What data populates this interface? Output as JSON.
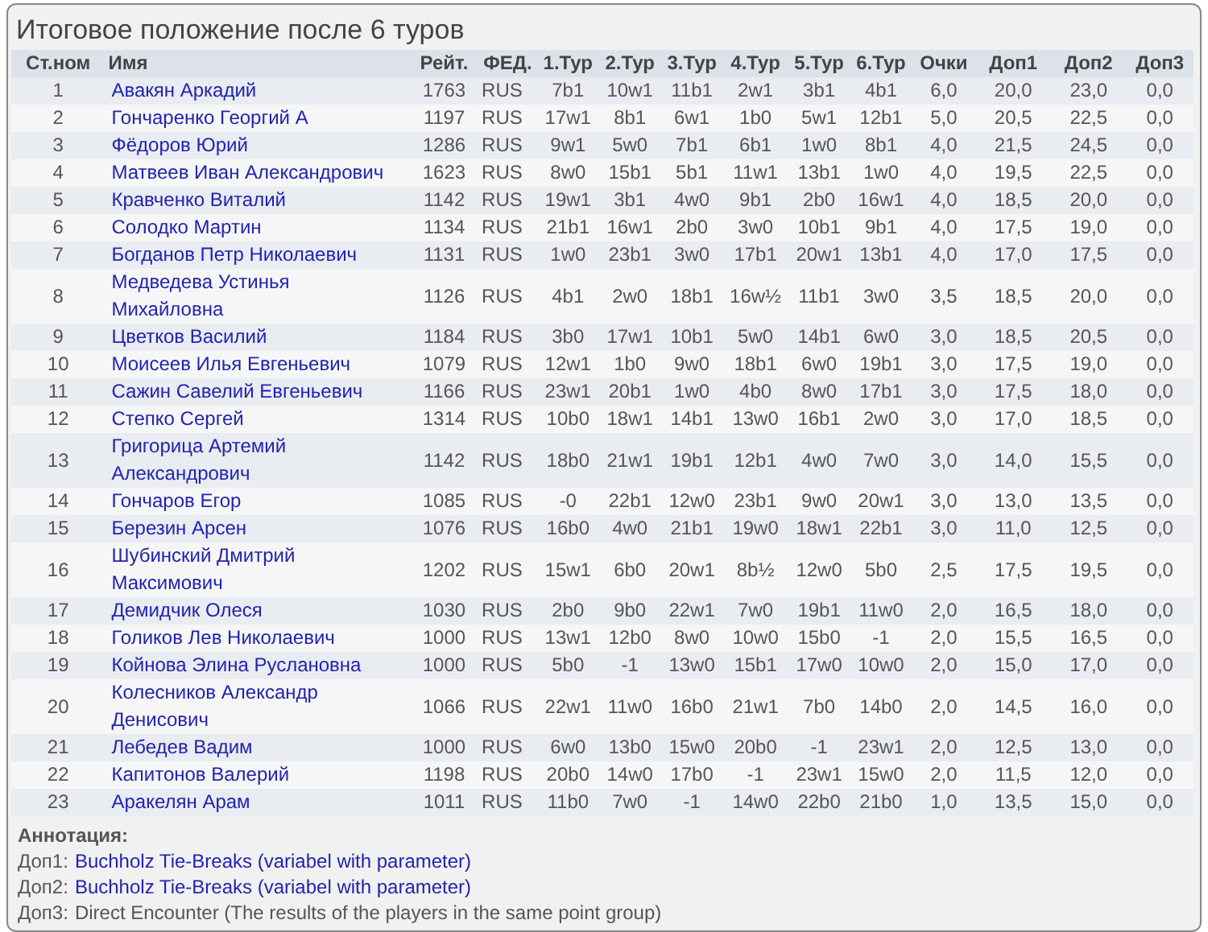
{
  "title": "Итоговое положение после 6 туров",
  "table": {
    "columns": [
      "Ст.ном",
      "Имя",
      "Рейт.",
      "ФЕД.",
      "1.Тур",
      "2.Тур",
      "3.Тур",
      "4.Тур",
      "5.Тур",
      "6.Тур",
      "Очки",
      "Доп1",
      "Доп2",
      "Доп3"
    ],
    "rows": [
      {
        "rank": "1",
        "name": "Авакян Аркадий",
        "rating": "1763",
        "fed": "RUS",
        "rounds": [
          "7b1",
          "10w1",
          "11b1",
          "2w1",
          "3b1",
          "4b1"
        ],
        "points": "6,0",
        "tb1": "20,0",
        "tb2": "23,0",
        "tb3": "0,0"
      },
      {
        "rank": "2",
        "name": "Гончаренко Георгий А",
        "rating": "1197",
        "fed": "RUS",
        "rounds": [
          "17w1",
          "8b1",
          "6w1",
          "1b0",
          "5w1",
          "12b1"
        ],
        "points": "5,0",
        "tb1": "20,5",
        "tb2": "22,5",
        "tb3": "0,0"
      },
      {
        "rank": "3",
        "name": "Фёдоров Юрий",
        "rating": "1286",
        "fed": "RUS",
        "rounds": [
          "9w1",
          "5w0",
          "7b1",
          "6b1",
          "1w0",
          "8b1"
        ],
        "points": "4,0",
        "tb1": "21,5",
        "tb2": "24,5",
        "tb3": "0,0"
      },
      {
        "rank": "4",
        "name": "Матвеев Иван Александрович",
        "rating": "1623",
        "fed": "RUS",
        "rounds": [
          "8w0",
          "15b1",
          "5b1",
          "11w1",
          "13b1",
          "1w0"
        ],
        "points": "4,0",
        "tb1": "19,5",
        "tb2": "22,5",
        "tb3": "0,0"
      },
      {
        "rank": "5",
        "name": "Кравченко Виталий",
        "rating": "1142",
        "fed": "RUS",
        "rounds": [
          "19w1",
          "3b1",
          "4w0",
          "9b1",
          "2b0",
          "16w1"
        ],
        "points": "4,0",
        "tb1": "18,5",
        "tb2": "20,0",
        "tb3": "0,0"
      },
      {
        "rank": "6",
        "name": "Солодко Мартин",
        "rating": "1134",
        "fed": "RUS",
        "rounds": [
          "21b1",
          "16w1",
          "2b0",
          "3w0",
          "10b1",
          "9b1"
        ],
        "points": "4,0",
        "tb1": "17,5",
        "tb2": "19,0",
        "tb3": "0,0"
      },
      {
        "rank": "7",
        "name": "Богданов Петр Николаевич",
        "rating": "1131",
        "fed": "RUS",
        "rounds": [
          "1w0",
          "23b1",
          "3w0",
          "17b1",
          "20w1",
          "13b1"
        ],
        "points": "4,0",
        "tb1": "17,0",
        "tb2": "17,5",
        "tb3": "0,0"
      },
      {
        "rank": "8",
        "name": "Медведева Устинья Михайловна",
        "rating": "1126",
        "fed": "RUS",
        "rounds": [
          "4b1",
          "2w0",
          "18b1",
          "16w½",
          "11b1",
          "3w0"
        ],
        "points": "3,5",
        "tb1": "18,5",
        "tb2": "20,0",
        "tb3": "0,0"
      },
      {
        "rank": "9",
        "name": "Цветков Василий",
        "rating": "1184",
        "fed": "RUS",
        "rounds": [
          "3b0",
          "17w1",
          "10b1",
          "5w0",
          "14b1",
          "6w0"
        ],
        "points": "3,0",
        "tb1": "18,5",
        "tb2": "20,5",
        "tb3": "0,0"
      },
      {
        "rank": "10",
        "name": "Моисеев Илья Евгеньевич",
        "rating": "1079",
        "fed": "RUS",
        "rounds": [
          "12w1",
          "1b0",
          "9w0",
          "18b1",
          "6w0",
          "19b1"
        ],
        "points": "3,0",
        "tb1": "17,5",
        "tb2": "19,0",
        "tb3": "0,0"
      },
      {
        "rank": "11",
        "name": "Сажин Савелий Евгеньевич",
        "rating": "1166",
        "fed": "RUS",
        "rounds": [
          "23w1",
          "20b1",
          "1w0",
          "4b0",
          "8w0",
          "17b1"
        ],
        "points": "3,0",
        "tb1": "17,5",
        "tb2": "18,0",
        "tb3": "0,0"
      },
      {
        "rank": "12",
        "name": "Степко Сергей",
        "rating": "1314",
        "fed": "RUS",
        "rounds": [
          "10b0",
          "18w1",
          "14b1",
          "13w0",
          "16b1",
          "2w0"
        ],
        "points": "3,0",
        "tb1": "17,0",
        "tb2": "18,5",
        "tb3": "0,0"
      },
      {
        "rank": "13",
        "name": "Григорица Артемий Александрович",
        "rating": "1142",
        "fed": "RUS",
        "rounds": [
          "18b0",
          "21w1",
          "19b1",
          "12b1",
          "4w0",
          "7w0"
        ],
        "points": "3,0",
        "tb1": "14,0",
        "tb2": "15,5",
        "tb3": "0,0"
      },
      {
        "rank": "14",
        "name": "Гончаров Егор",
        "rating": "1085",
        "fed": "RUS",
        "rounds": [
          "-0",
          "22b1",
          "12w0",
          "23b1",
          "9w0",
          "20w1"
        ],
        "points": "3,0",
        "tb1": "13,0",
        "tb2": "13,5",
        "tb3": "0,0"
      },
      {
        "rank": "15",
        "name": "Березин Арсен",
        "rating": "1076",
        "fed": "RUS",
        "rounds": [
          "16b0",
          "4w0",
          "21b1",
          "19w0",
          "18w1",
          "22b1"
        ],
        "points": "3,0",
        "tb1": "11,0",
        "tb2": "12,5",
        "tb3": "0,0"
      },
      {
        "rank": "16",
        "name": "Шубинский Дмитрий Максимович",
        "rating": "1202",
        "fed": "RUS",
        "rounds": [
          "15w1",
          "6b0",
          "20w1",
          "8b½",
          "12w0",
          "5b0"
        ],
        "points": "2,5",
        "tb1": "17,5",
        "tb2": "19,5",
        "tb3": "0,0"
      },
      {
        "rank": "17",
        "name": "Демидчик Олеся",
        "rating": "1030",
        "fed": "RUS",
        "rounds": [
          "2b0",
          "9b0",
          "22w1",
          "7w0",
          "19b1",
          "11w0"
        ],
        "points": "2,0",
        "tb1": "16,5",
        "tb2": "18,0",
        "tb3": "0,0"
      },
      {
        "rank": "18",
        "name": "Голиков Лев Николаевич",
        "rating": "1000",
        "fed": "RUS",
        "rounds": [
          "13w1",
          "12b0",
          "8w0",
          "10w0",
          "15b0",
          "-1"
        ],
        "points": "2,0",
        "tb1": "15,5",
        "tb2": "16,5",
        "tb3": "0,0"
      },
      {
        "rank": "19",
        "name": "Койнова Элина Руслановна",
        "rating": "1000",
        "fed": "RUS",
        "rounds": [
          "5b0",
          "-1",
          "13w0",
          "15b1",
          "17w0",
          "10w0"
        ],
        "points": "2,0",
        "tb1": "15,0",
        "tb2": "17,0",
        "tb3": "0,0"
      },
      {
        "rank": "20",
        "name": "Колесников Александр Денисович",
        "rating": "1066",
        "fed": "RUS",
        "rounds": [
          "22w1",
          "11w0",
          "16b0",
          "21w1",
          "7b0",
          "14b0"
        ],
        "points": "2,0",
        "tb1": "14,5",
        "tb2": "16,0",
        "tb3": "0,0"
      },
      {
        "rank": "21",
        "name": "Лебедев Вадим",
        "rating": "1000",
        "fed": "RUS",
        "rounds": [
          "6w0",
          "13b0",
          "15w0",
          "20b0",
          "-1",
          "23w1"
        ],
        "points": "2,0",
        "tb1": "12,5",
        "tb2": "13,0",
        "tb3": "0,0"
      },
      {
        "rank": "22",
        "name": "Капитонов Валерий",
        "rating": "1198",
        "fed": "RUS",
        "rounds": [
          "20b0",
          "14w0",
          "17b0",
          "-1",
          "23w1",
          "15w0"
        ],
        "points": "2,0",
        "tb1": "11,5",
        "tb2": "12,0",
        "tb3": "0,0"
      },
      {
        "rank": "23",
        "name": "Аракелян Арам",
        "rating": "1011",
        "fed": "RUS",
        "rounds": [
          "11b0",
          "7w0",
          "-1",
          "14w0",
          "22b0",
          "21b0"
        ],
        "points": "1,0",
        "tb1": "13,5",
        "tb2": "15,0",
        "tb3": "0,0"
      }
    ]
  },
  "annotation": {
    "heading": "Аннотация:",
    "lines": [
      {
        "kind": "link",
        "label": "Доп1:",
        "text": "Buchholz Tie-Breaks (variabel with parameter)"
      },
      {
        "kind": "link",
        "label": "Доп2:",
        "text": "Buchholz Tie-Breaks (variabel with parameter)"
      },
      {
        "kind": "plain",
        "label": "Доп3:",
        "text": "Direct Encounter (The results of the players in the same point group)"
      }
    ]
  }
}
